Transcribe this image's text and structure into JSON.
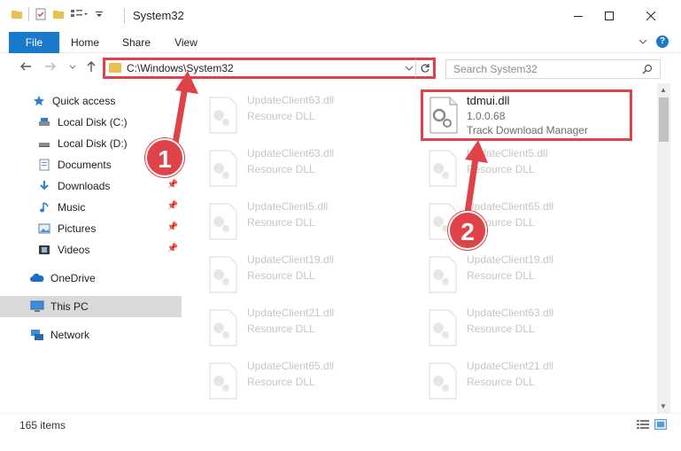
{
  "window": {
    "title": "System32",
    "minimize_icon": "minimize-icon",
    "maximize_icon": "maximize-icon",
    "close_icon": "close-icon"
  },
  "ribbon": {
    "tabs": [
      {
        "label": "File"
      },
      {
        "label": "Home"
      },
      {
        "label": "Share"
      },
      {
        "label": "View"
      }
    ]
  },
  "address_bar": {
    "path": "C:\\Windows\\System32"
  },
  "search": {
    "placeholder": "Search System32"
  },
  "sidebar": {
    "items": [
      {
        "label": "Quick access",
        "icon": "star-icon"
      },
      {
        "label": "Local Disk (C:)",
        "icon": "drive-icon"
      },
      {
        "label": "Local Disk (D:)",
        "icon": "drive-icon"
      },
      {
        "label": "Documents",
        "icon": "documents-icon"
      },
      {
        "label": "Downloads",
        "icon": "download-icon",
        "pinned": true
      },
      {
        "label": "Music",
        "icon": "music-icon",
        "pinned": true
      },
      {
        "label": "Pictures",
        "icon": "pictures-icon",
        "pinned": true
      },
      {
        "label": "Videos",
        "icon": "videos-icon",
        "pinned": true
      },
      {
        "label": "OneDrive",
        "icon": "cloud-icon"
      },
      {
        "label": "This PC",
        "icon": "computer-icon"
      },
      {
        "label": "Network",
        "icon": "network-icon"
      }
    ]
  },
  "files": {
    "highlighted": {
      "name": "tdmui.dll",
      "version": "1.0.0.68",
      "description": "Track Download Manager"
    },
    "left_column": [
      {
        "name": "UpdateClient63.dll",
        "type": "Resource DLL"
      },
      {
        "name": "UpdateClient63.dll",
        "type": "Resource DLL"
      },
      {
        "name": "UpdateClient5.dll",
        "type": "Resource DLL"
      },
      {
        "name": "UpdateClient19.dll",
        "type": "Resource DLL"
      },
      {
        "name": "UpdateClient21.dll",
        "type": "Resource DLL"
      },
      {
        "name": "UpdateClient65.dll",
        "type": "Resource DLL"
      }
    ],
    "right_column": [
      {
        "name": "UpdateClient5.dll",
        "type": "Resource DLL"
      },
      {
        "name": "UpdateClient65.dll",
        "type": "Resource DLL"
      },
      {
        "name": "UpdateClient19.dll",
        "type": "Resource DLL"
      },
      {
        "name": "UpdateClient63.dll",
        "type": "Resource DLL"
      },
      {
        "name": "UpdateClient21.dll",
        "type": "Resource DLL"
      }
    ]
  },
  "status": {
    "item_count": "165 items"
  },
  "annotations": {
    "step1": "1",
    "step2": "2",
    "color": "#e04249"
  }
}
